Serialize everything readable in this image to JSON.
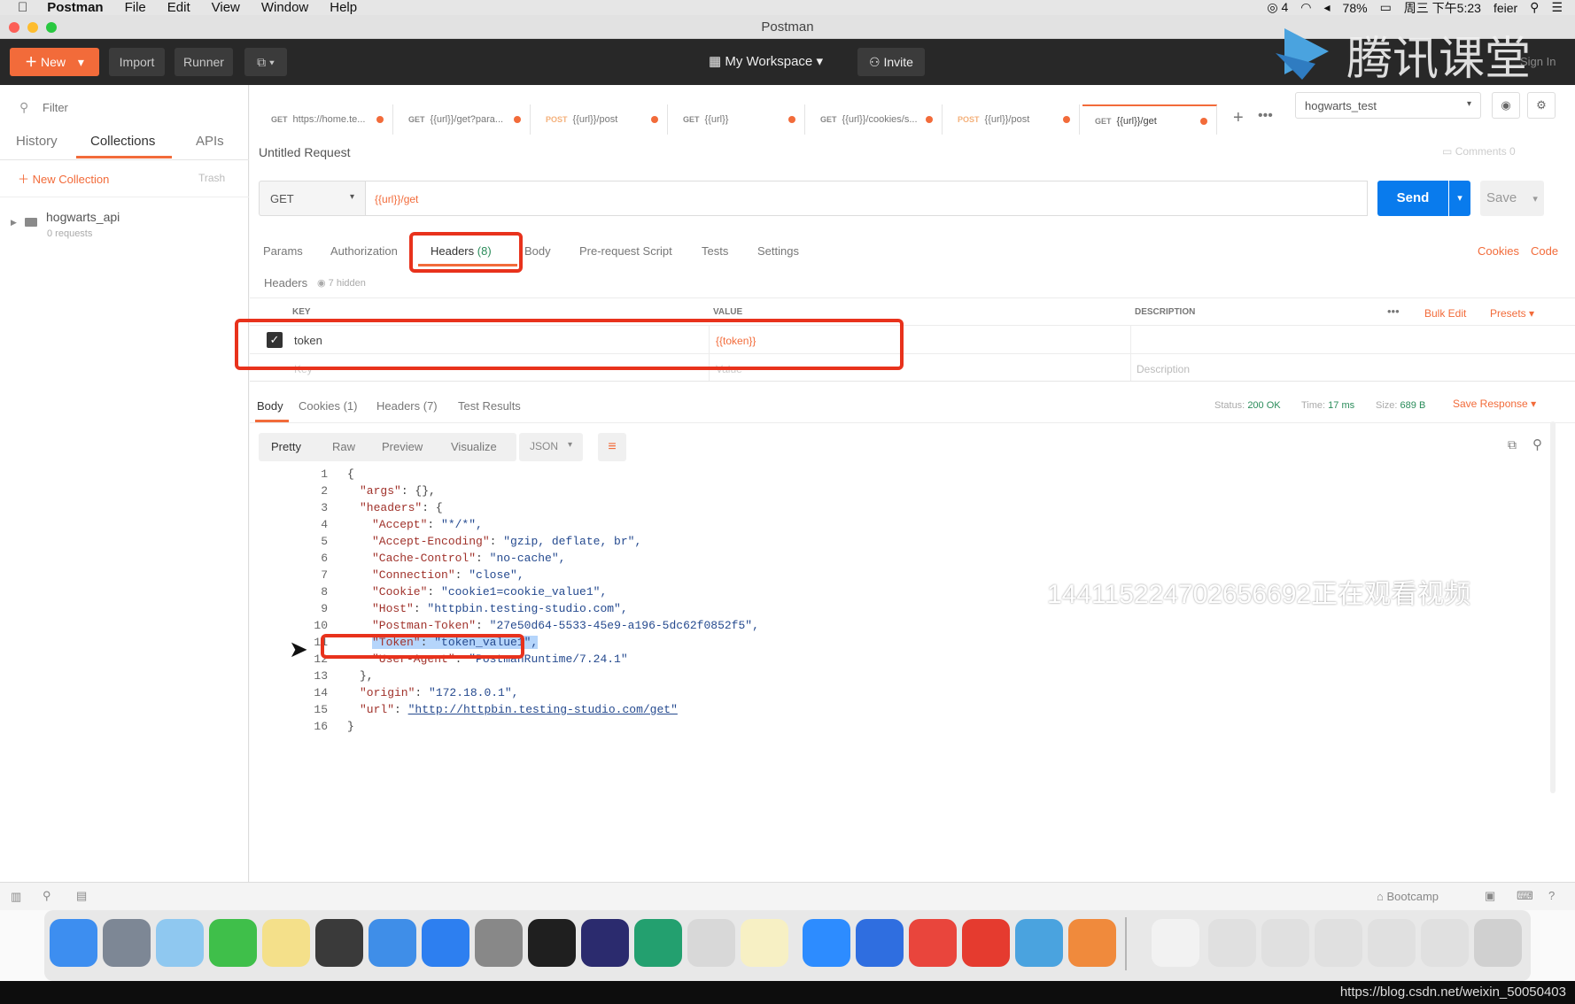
{
  "menubar": {
    "app": "Postman",
    "items": [
      "File",
      "Edit",
      "View",
      "Window",
      "Help"
    ],
    "battery": "78%",
    "time": "周三 下午5:23",
    "user": "feier",
    "wechat_count": "4"
  },
  "window": {
    "title": "Postman"
  },
  "toolbar": {
    "new": "New",
    "import": "Import",
    "runner": "Runner",
    "workspace": "My Workspace",
    "invite": "Invite",
    "signin": "Sign In",
    "watermark_logo": "腾讯课堂"
  },
  "sidebar": {
    "filter_placeholder": "Filter",
    "tabs": [
      "History",
      "Collections",
      "APIs"
    ],
    "new_collection": "New Collection",
    "trash": "Trash",
    "collection_name": "hogwarts_api",
    "collection_meta": "0 requests"
  },
  "tabs": [
    {
      "method": "GET",
      "label": "https://home.te..."
    },
    {
      "method": "GET",
      "label": "{{url}}/get?para..."
    },
    {
      "method": "POST",
      "label": "{{url}}/post"
    },
    {
      "method": "GET",
      "label": "{{url}}"
    },
    {
      "method": "GET",
      "label": "{{url}}/cookies/s..."
    },
    {
      "method": "POST",
      "label": "{{url}}/post"
    },
    {
      "method": "GET",
      "label": "{{url}}/get"
    }
  ],
  "environment": "hogwarts_test",
  "request": {
    "name": "Untitled Request",
    "comments": "Comments",
    "comments_count": "0",
    "method": "GET",
    "url": "{{url}}/get",
    "send": "Send",
    "save": "Save"
  },
  "req_tabs": {
    "params": "Params",
    "auth": "Authorization",
    "headers": "Headers",
    "headers_count": "(8)",
    "body": "Body",
    "prereq": "Pre-request Script",
    "tests": "Tests",
    "settings": "Settings",
    "cookies": "Cookies",
    "code": "Code"
  },
  "headers_section": {
    "title": "Headers",
    "hidden": "7 hidden",
    "col_key": "KEY",
    "col_value": "VALUE",
    "col_desc": "DESCRIPTION",
    "bulk_edit": "Bulk Edit",
    "presets": "Presets",
    "row_key": "token",
    "row_value": "{{token}}",
    "key_placeholder": "Key",
    "value_placeholder": "Value",
    "desc_placeholder": "Description"
  },
  "response": {
    "tabs": [
      "Body",
      "Cookies (1)",
      "Headers (7)",
      "Test Results"
    ],
    "status_label": "Status:",
    "status": "200 OK",
    "time_label": "Time:",
    "time": "17 ms",
    "size_label": "Size:",
    "size": "689 B",
    "save_response": "Save Response",
    "views": [
      "Pretty",
      "Raw",
      "Preview",
      "Visualize"
    ],
    "format": "JSON"
  },
  "code_lines": [
    {
      "n": "1",
      "text": "{"
    },
    {
      "n": "2",
      "key": "\"args\"",
      "val": "{},"
    },
    {
      "n": "3",
      "key": "\"headers\"",
      "val": "{"
    },
    {
      "n": "4",
      "key": "\"Accept\"",
      "val": "\"*/*\","
    },
    {
      "n": "5",
      "key": "\"Accept-Encoding\"",
      "val": "\"gzip, deflate, br\","
    },
    {
      "n": "6",
      "key": "\"Cache-Control\"",
      "val": "\"no-cache\","
    },
    {
      "n": "7",
      "key": "\"Connection\"",
      "val": "\"close\","
    },
    {
      "n": "8",
      "key": "\"Cookie\"",
      "val": "\"cookie1=cookie_value1\","
    },
    {
      "n": "9",
      "key": "\"Host\"",
      "val": "\"httpbin.testing-studio.com\","
    },
    {
      "n": "10",
      "key": "\"Postman-Token\"",
      "val": "\"27e50d64-5533-45e9-a196-5dc62f0852f5\","
    },
    {
      "n": "11",
      "key": "\"Token\"",
      "val": "\"token_value1\","
    },
    {
      "n": "12",
      "key": "\"User-Agent\"",
      "val": "\"PostmanRuntime/7.24.1\""
    },
    {
      "n": "13",
      "text": "},"
    },
    {
      "n": "14",
      "key": "\"origin\"",
      "val": "\"172.18.0.1\","
    },
    {
      "n": "15",
      "key": "\"url\"",
      "val": "\"http://httpbin.testing-studio.com/get\""
    },
    {
      "n": "16",
      "text": "}"
    }
  ],
  "overlay": {
    "viewer_text": "1441152247026566​92正在观看视频"
  },
  "statusbar": {
    "bootcamp": "Bootcamp"
  },
  "url_footer": "https://blog.csdn.net/weixin_50050403",
  "colors": {
    "accent": "#f26b3a",
    "send_blue": "#097bed",
    "highlight_red": "#e8321c"
  }
}
